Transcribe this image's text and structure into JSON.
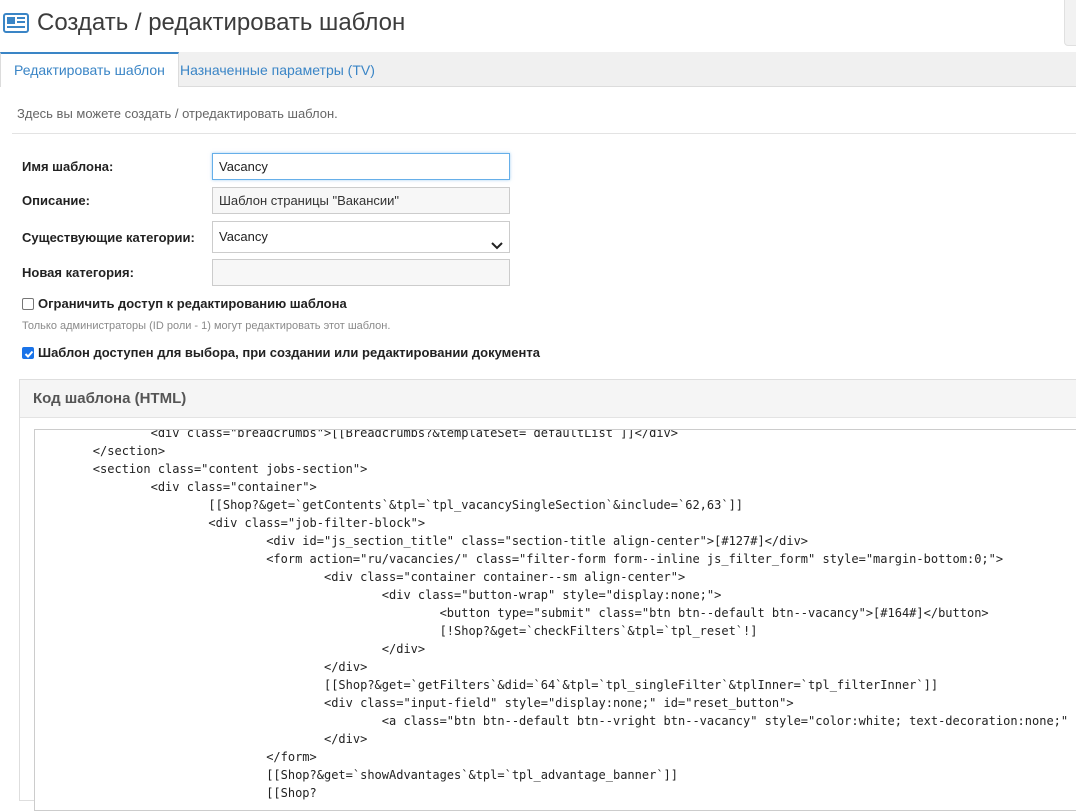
{
  "header": {
    "title": "Создать / редактировать шаблон",
    "icon": "template-icon"
  },
  "tabs": [
    {
      "label": "Редактировать шаблон",
      "active": true
    },
    {
      "label": "Назначенные параметры (TV)",
      "active": false
    }
  ],
  "intro": "Здесь вы можете создать / отредактировать шаблон.",
  "form": {
    "name_label": "Имя шаблона:",
    "name_value": "Vacancy",
    "description_label": "Описание:",
    "description_value": "Шаблон страницы \"Вакансии\"",
    "categories_label": "Существующие категории:",
    "categories_value": "Vacancy",
    "new_category_label": "Новая категория:",
    "new_category_value": "",
    "restrict_label": "Ограничить доступ к редактированию шаблона",
    "restrict_checked": false,
    "restrict_hint": "Только администраторы (ID роли - 1) могут редактировать этот шаблон.",
    "selectable_label": "Шаблон доступен для выбора, при создании или редактировании документа",
    "selectable_checked": true
  },
  "code_panel": {
    "title": "Код шаблона (HTML)",
    "lines": [
      "\t\t<div class=\"breadcrumbs\">[[Breadcrumbs?&templateSet=`defaultList`]]</div>",
      "\t</section>",
      "\t<section class=\"content jobs-section\">",
      "\t\t<div class=\"container\">",
      "\t\t\t[[Shop?&get=`getContents`&tpl=`tpl_vacancySingleSection`&include=`62,63`]]",
      "\t\t\t<div class=\"job-filter-block\">",
      "\t\t\t\t<div id=\"js_section_title\" class=\"section-title align-center\">[#127#]</div>",
      "\t\t\t\t<form action=\"ru/vacancies/\" class=\"filter-form form--inline js_filter_form\" style=\"margin-bottom:0;\">",
      "\t\t\t\t\t<div class=\"container container--sm align-center\">",
      "\t\t\t\t\t\t<div class=\"button-wrap\" style=\"display:none;\">",
      "\t\t\t\t\t\t\t<button type=\"submit\" class=\"btn btn--default btn--vacancy\">[#164#]</button>",
      "\t\t\t\t\t\t\t[!Shop?&get=`checkFilters`&tpl=`tpl_reset`!]",
      "\t\t\t\t\t\t</div>",
      "\t\t\t\t\t</div>",
      "\t\t\t\t\t[[Shop?&get=`getFilters`&did=`64`&tpl=`tpl_singleFilter`&tplInner=`tpl_filterInner`]]",
      "\t\t\t\t\t<div class=\"input-field\" style=\"display:none;\" id=\"reset_button\">",
      "\t\t\t\t\t\t<a class=\"btn btn--default btn--vright btn--vacancy\" style=\"color:white; text-decoration:none;\" href=",
      "\t\t\t\t\t</div>",
      "\t\t\t\t</form>",
      "\t\t\t\t[[Shop?&get=`showAdvantages`&tpl=`tpl_advantage_banner`]]",
      "\t\t\t\t[[Shop?"
    ]
  },
  "colors": {
    "accent": "#3a85c6",
    "checkbox": "#1a73e8",
    "focus_border": "#66afe9"
  }
}
